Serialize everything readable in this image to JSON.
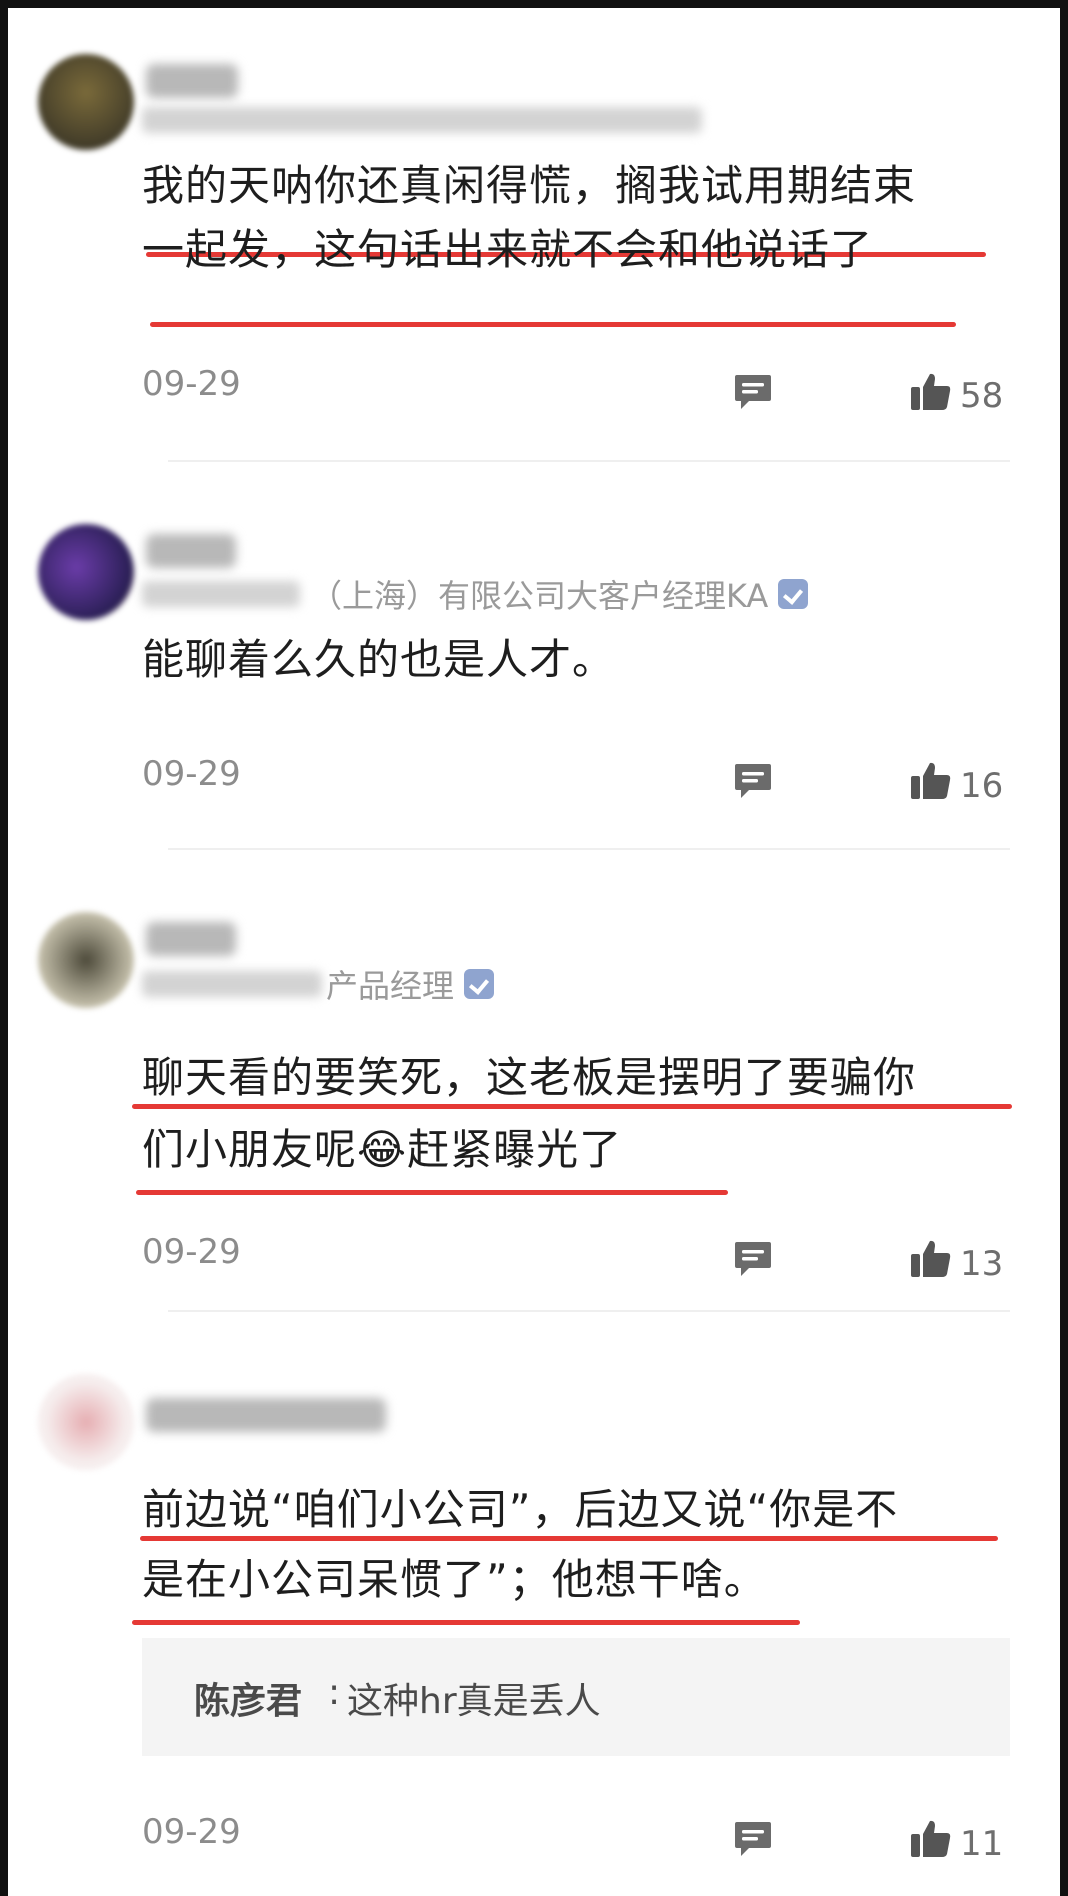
{
  "comments": [
    {
      "lines": [
        "我的天呐你还真闲得慌，搁我试用期结束",
        "一起发，这句话出来就不会和他说话了"
      ],
      "date": "09-29",
      "likes": "58"
    },
    {
      "subtitle": "（上海）有限公司大客户经理KA",
      "lines": [
        "能聊着么久的也是人才。"
      ],
      "date": "09-29",
      "likes": "16"
    },
    {
      "subtitle": "产品经理",
      "lines": [
        "聊天看的要笑死，这老板是摆明了要骗你",
        "们小朋友呢😂赶紧曝光了"
      ],
      "date": "09-29",
      "likes": "13"
    },
    {
      "lines": [
        "前边说“咱们小公司”，后边又说“你是不",
        "是在小公司呆惯了”；他想干啥。"
      ],
      "reply": {
        "author": "陈彦君",
        "separator": ":",
        "text": "这种hr真是丢人"
      },
      "date": "09-29",
      "likes": "11"
    }
  ],
  "colors": {
    "underline": "#e53935",
    "verified_badge": "#8fa4cf"
  },
  "icons": {
    "reply": "comment-bubble-icon",
    "like": "thumbs-up-icon",
    "verified": "verified-badge-icon"
  }
}
